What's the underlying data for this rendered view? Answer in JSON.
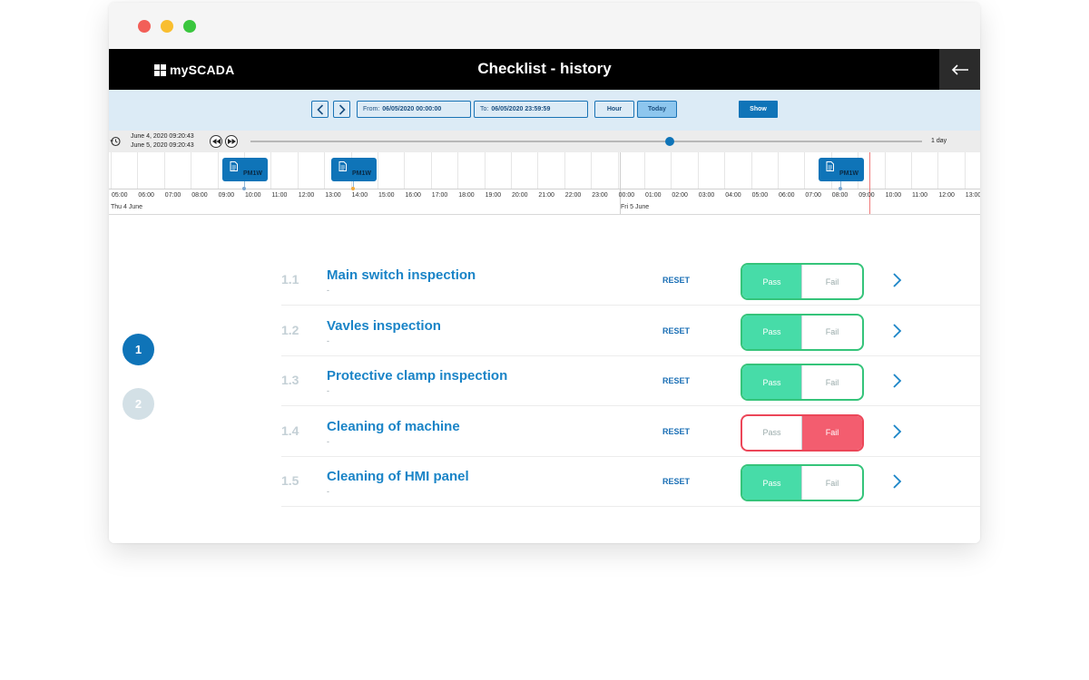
{
  "app": {
    "logo_text": "mySCADA",
    "title": "Checklist - history"
  },
  "toolbar": {
    "from_prefix": "From:",
    "from_value": "06/05/2020 00:00:00",
    "to_prefix": "To:",
    "to_value": "06/05/2020 23:59:59",
    "hour_label": "Hour",
    "today_label": "Today",
    "show_label": "Show"
  },
  "slider": {
    "range_start": "June 4, 2020 09:20:43",
    "range_end": "June 5, 2020 09:20:43",
    "zoom_label": "1 day",
    "position_fraction": 0.64
  },
  "timeline": {
    "ticks": [
      "05:00",
      "06:00",
      "07:00",
      "08:00",
      "09:00",
      "10:00",
      "11:00",
      "12:00",
      "13:00",
      "14:00",
      "15:00",
      "16:00",
      "17:00",
      "18:00",
      "19:00",
      "20:00",
      "21:00",
      "22:00",
      "23:00",
      "00:00",
      "01:00",
      "02:00",
      "03:00",
      "04:00",
      "05:00",
      "06:00",
      "07:00",
      "08:00",
      "09:00",
      "10:00",
      "11:00",
      "12:00",
      "13:00"
    ],
    "day_labels": [
      "Thu 4 June",
      "Fri 5 June"
    ],
    "events": [
      {
        "label": "PM1W",
        "pin_color": "#7aa6cf"
      },
      {
        "label": "PM1W",
        "pin_color": "#f2a93b"
      },
      {
        "label": "PM1W",
        "pin_color": "#7aa6cf"
      }
    ]
  },
  "pagination": {
    "pages": [
      "1",
      "2"
    ],
    "current": "1"
  },
  "checklist": [
    {
      "num": "1.1",
      "title": "Main switch inspection",
      "sub": "-",
      "reset": "RESET",
      "pass": "Pass",
      "fail": "Fail",
      "state": "pass"
    },
    {
      "num": "1.2",
      "title": "Vavles inspection",
      "sub": "-",
      "reset": "RESET",
      "pass": "Pass",
      "fail": "Fail",
      "state": "pass"
    },
    {
      "num": "1.3",
      "title": "Protective clamp inspection",
      "sub": "-",
      "reset": "RESET",
      "pass": "Pass",
      "fail": "Fail",
      "state": "pass"
    },
    {
      "num": "1.4",
      "title": "Cleaning of machine",
      "sub": "-",
      "reset": "RESET",
      "pass": "Pass",
      "fail": "Fail",
      "state": "fail"
    },
    {
      "num": "1.5",
      "title": "Cleaning of HMI panel",
      "sub": "-",
      "reset": "RESET",
      "pass": "Pass",
      "fail": "Fail",
      "state": "pass"
    }
  ],
  "colors": {
    "brand_blue": "#0f74b8",
    "pass_green": "#47dca8",
    "fail_red": "#f35d6f"
  }
}
